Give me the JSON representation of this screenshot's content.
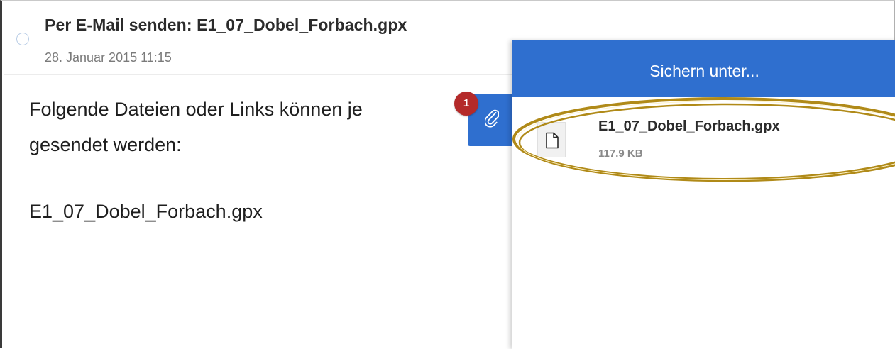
{
  "email": {
    "subject": "Per E-Mail senden: E1_07_Dobel_Forbach.gpx",
    "date": "28. Januar 2015 11:15",
    "body_line1": "Folgende Dateien oder Links können je",
    "body_line2": "gesendet werden:",
    "body_filename": "E1_07_Dobel_Forbach.gpx"
  },
  "attachments": {
    "badge_count": "1",
    "icon": "paperclip-icon"
  },
  "save_panel": {
    "title": "Sichern unter...",
    "file": {
      "name": "E1_07_Dobel_Forbach.gpx",
      "size": "117.9 KB",
      "icon": "document-icon"
    }
  },
  "colors": {
    "accent_blue": "#2f6fcf",
    "badge_red": "#b42a2a",
    "highlight_gold": "#b08a18"
  }
}
